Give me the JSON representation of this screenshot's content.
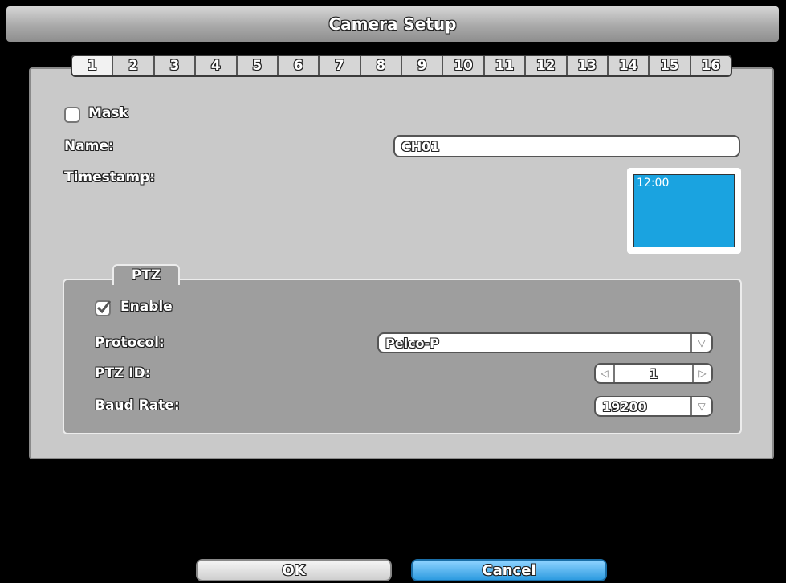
{
  "window": {
    "title": "Camera Setup"
  },
  "channels": [
    "1",
    "2",
    "3",
    "4",
    "5",
    "6",
    "7",
    "8",
    "9",
    "10",
    "11",
    "12",
    "13",
    "14",
    "15",
    "16"
  ],
  "mask": {
    "label": "Mask",
    "checked": false
  },
  "name": {
    "label": "Name:",
    "value": "CH01"
  },
  "timestamp": {
    "label": "Timestamp:",
    "preview": "12:00"
  },
  "ptz": {
    "tab_label": "PTZ",
    "enable": {
      "label": "Enable",
      "checked": true
    },
    "protocol": {
      "label": "Protocol:",
      "value": "Pelco-P"
    },
    "ptz_id": {
      "label": "PTZ ID:",
      "value": "1"
    },
    "baud_rate": {
      "label": "Baud Rate:",
      "value": "19200"
    }
  },
  "buttons": {
    "ok": "OK",
    "cancel": "Cancel"
  },
  "colors": {
    "accent": "#2d9be0",
    "preview_bg": "#1aa3e0",
    "panel": "#c9c9c9",
    "ptz_panel": "#9e9e9e"
  }
}
